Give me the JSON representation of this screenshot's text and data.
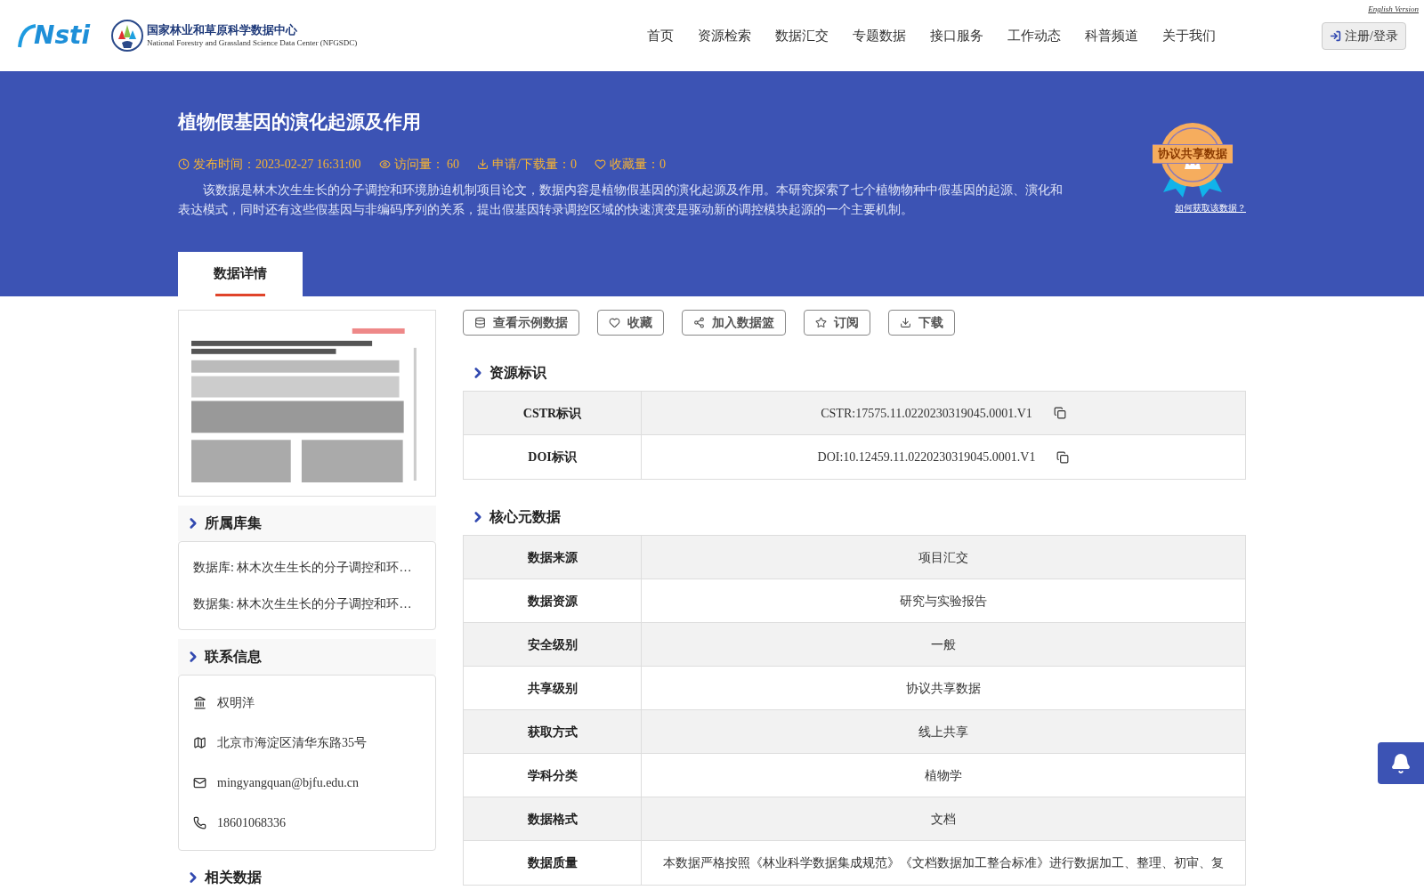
{
  "header": {
    "logo_text": "Nsti",
    "org_name": "国家林业和草原科学数据中心",
    "org_name_en": "National Forestry and Grassland Science Data Center (NFGSDC)",
    "english_link": "English Version",
    "nav": [
      "首页",
      "资源检索",
      "数据汇交",
      "专题数据",
      "接口服务",
      "工作动态",
      "科普频道",
      "关于我们"
    ],
    "login_button": "注册/登录"
  },
  "banner": {
    "title": "植物假基因的演化起源及作用",
    "meta": [
      {
        "kind": "time",
        "text": "发布时间：2023-02-27 16:31:00"
      },
      {
        "kind": "views",
        "text": "访问量： 60"
      },
      {
        "kind": "downloads",
        "text": "申请/下载量：0"
      },
      {
        "kind": "favorites",
        "text": "收藏量：0"
      }
    ],
    "description": "该数据是林木次生生长的分子调控和环境胁迫机制项目论文，数据内容是植物假基因的演化起源及作用。本研究探索了七个植物物种中假基因的起源、演化和表达模式，同时还有这些假基因与非编码序列的关系，提出假基因转录调控区域的快速演变是驱动新的调控模块起源的一个主要机制。",
    "badge_text": "协议共享数据",
    "badge_link": "如何获取该数据？",
    "tabs": [
      {
        "label": "数据详情",
        "selected": true
      }
    ]
  },
  "sidebar": {
    "sections": [
      {
        "kind": "links",
        "title": "所属库集",
        "items": [
          "数据库: 林木次生生长的分子调控和环…",
          "数据集: 林木次生生长的分子调控和环…"
        ]
      },
      {
        "kind": "contact",
        "title": "联系信息",
        "items": [
          {
            "kind": "org",
            "text": "权明洋"
          },
          {
            "kind": "address",
            "text": "北京市海淀区清华东路35号"
          },
          {
            "kind": "email",
            "text": "mingyangquan@bjfu.edu.cn"
          },
          {
            "kind": "phone",
            "text": "18601068336"
          }
        ]
      },
      {
        "kind": "heading",
        "title": "相关数据"
      }
    ]
  },
  "actions": [
    {
      "kind": "sample",
      "label": "查看示例数据"
    },
    {
      "kind": "favorite",
      "label": "收藏"
    },
    {
      "kind": "basket",
      "label": "加入数据篮"
    },
    {
      "kind": "subscribe",
      "label": "订阅"
    },
    {
      "kind": "download",
      "label": "下载"
    }
  ],
  "identifiers": {
    "title": "资源标识",
    "rows": [
      {
        "label": "CSTR标识",
        "value": "CSTR:17575.11.0220230319045.0001.V1"
      },
      {
        "label": "DOI标识",
        "value": "DOI:10.12459.11.0220230319045.0001.V1"
      }
    ]
  },
  "core_metadata": {
    "title": "核心元数据",
    "rows": [
      {
        "label": "数据来源",
        "value": "项目汇交"
      },
      {
        "label": "数据资源",
        "value": "研究与实验报告"
      },
      {
        "label": "安全级别",
        "value": "一般"
      },
      {
        "label": "共享级别",
        "value": "协议共享数据"
      },
      {
        "label": "获取方式",
        "value": "线上共享"
      },
      {
        "label": "学科分类",
        "value": "植物学"
      },
      {
        "label": "数据格式",
        "value": "文档"
      },
      {
        "label": "数据质量",
        "value": "本数据严格按照《林业科学数据集成规范》《文档数据加工整合标准》进行数据加工、整理、初审、复"
      }
    ]
  }
}
